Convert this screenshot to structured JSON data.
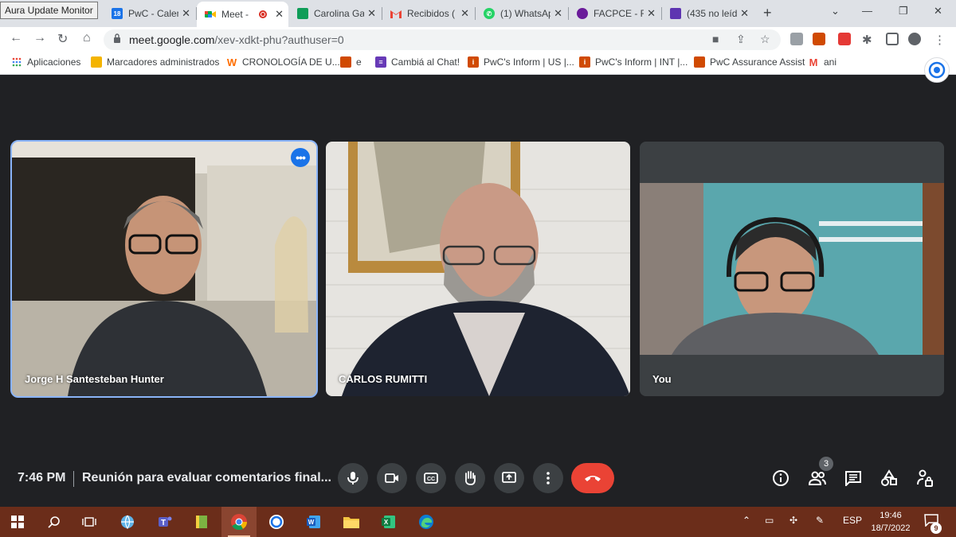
{
  "tooltip": "Aura Update Monitor",
  "tabs": [
    {
      "title": "PwC - Calen",
      "favicon_text": "18",
      "favicon_color": "#1a73e8"
    },
    {
      "title": "Meet -",
      "active": true,
      "favicon_color": "#00897b"
    },
    {
      "title": "Carolina Ga",
      "favicon_color": "#0f9d58"
    },
    {
      "title": "Recibidos (",
      "favicon_color": "#ea4335"
    },
    {
      "title": "(1) WhatsAp",
      "favicon_color": "#25d366"
    },
    {
      "title": "FACPCE - F",
      "favicon_color": "#6a1b9a"
    },
    {
      "title": "(435 no leíd",
      "favicon_color": "#5e35b1"
    }
  ],
  "address": {
    "host": "meet.google.com",
    "path": "/xev-xdkt-phu?authuser=0"
  },
  "bookmarks": [
    {
      "label": "Aplicaciones",
      "icon": "apps-grid-icon",
      "color": "#ea4335"
    },
    {
      "label": "Marcadores administrados",
      "icon": "folder-icon",
      "color": "#f4b400"
    },
    {
      "label": "CRONOLOGÍA DE U...",
      "icon": "w-icon",
      "color": "#ff6d00"
    },
    {
      "label": "e",
      "icon": "pwc-icon",
      "color": "#d04a02"
    },
    {
      "label": "Cambiá al Chat!",
      "icon": "form-icon",
      "color": "#673ab7"
    },
    {
      "label": "PwC's Inform | US |...",
      "icon": "pwc-icon",
      "color": "#d04a02"
    },
    {
      "label": "PwC's Inform | INT |...",
      "icon": "pwc-icon",
      "color": "#d04a02"
    },
    {
      "label": "PwC Assurance Assist",
      "icon": "pwc-icon",
      "color": "#d04a02"
    },
    {
      "label": "ani",
      "icon": "gmail-icon",
      "color": "#ea4335"
    }
  ],
  "participants": [
    {
      "name": "Jorge H Santesteban Hunter",
      "selected": true
    },
    {
      "name": "CARLOS RUMITTI"
    },
    {
      "name": "You"
    }
  ],
  "meeting": {
    "time": "7:46 PM",
    "title": "Reunión para evaluar comentarios final...",
    "participant_count": "3"
  },
  "colors": {
    "hangup": "#ea4335",
    "selected_outline": "#8ab4f8",
    "taskbar": "#6b2d1a"
  },
  "taskbar": {
    "language": "ESP",
    "time": "19:46",
    "date": "18/7/2022",
    "notifications": "9"
  }
}
